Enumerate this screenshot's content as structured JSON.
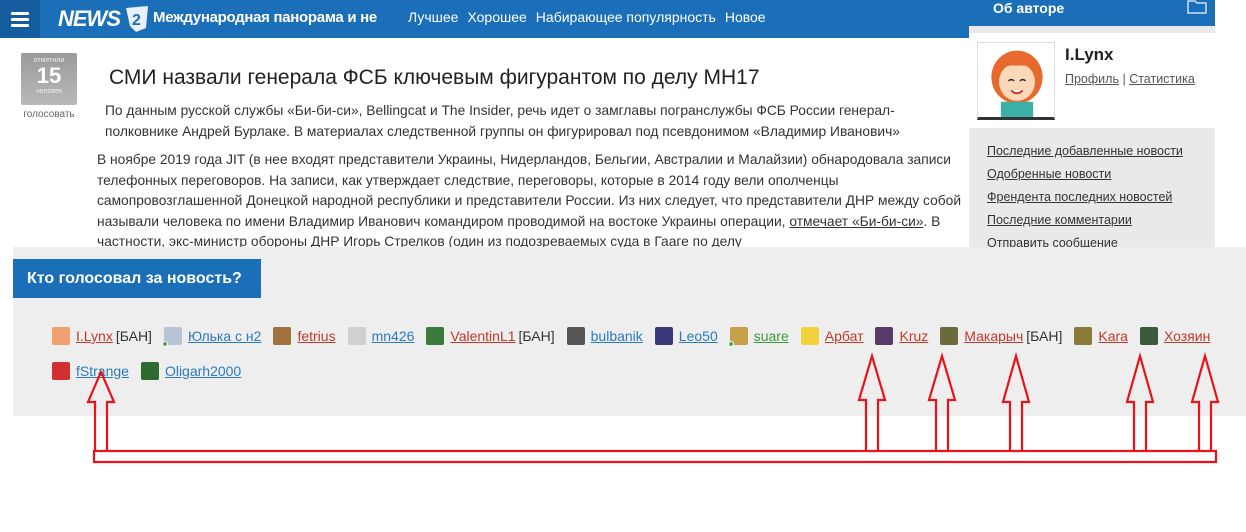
{
  "header": {
    "logo": "NEWS",
    "logo_badge": "2",
    "tagline": "Международная панорама и не",
    "nav": [
      "Лучшее",
      "Хорошее",
      "Набирающее популярность",
      "Новое"
    ]
  },
  "sidebar": {
    "title": "Об авторе",
    "author_name": "I.Lynx",
    "profile_link": "Профиль",
    "separator": "|",
    "stats_link": "Статистика",
    "links": [
      "Последние добавленные новости",
      "Одобренные новости",
      "Френдента последних новостей",
      "Последние комментарии",
      "Отправить сообщение"
    ]
  },
  "article": {
    "votes_top": "отметили",
    "votes_count": "15",
    "votes_unit": "человек",
    "vote_label": "голосовать",
    "title": "СМИ назвали генерала ФСБ ключевым фигурантом по делу MH17",
    "lead": "По данным русской службы «Би-би-си», Bellingcat и The Insider, речь идет о замглавы погранслужбы ФСБ России генерал-полковнике Андрей Бурлаке. В материалах следственной группы он фигурировал под псевдонимом «Владимир Иванович»",
    "body_main": "В ноябре 2019 года JIT (в нее входят представители Украины, Нидерландов, Бельгии, Австралии и Малайзии) обнародовала записи телефонных переговоров. На записи, как утверждает следствие, переговоры, которые в 2014 году вели ополченцы самопровозглашенной Донецкой народной республики и представители России. Из них следует, что представители ДНР между собой называли человека по имени Владимир Иванович командиром проводимой на востоке Украины операции,",
    "body_link": "отмечает «Би-би-си»",
    "body_tail": ". В частности, экс-министр обороны ДНР Игорь Стрелков (один из подозреваемых суда в Гааге по делу"
  },
  "voters": {
    "title": "Кто голосовал за новость?",
    "ban_label": "[БАН]",
    "rows": [
      [
        {
          "name": "I.Lynx",
          "color": "#c0392b",
          "ban": true,
          "av": "#f0a070",
          "online": false
        },
        {
          "name": "Юлька с н2",
          "color": "#2a7bbf",
          "ban": false,
          "av": "#b8c4d6",
          "online": true
        },
        {
          "name": "fetrius",
          "color": "#c0392b",
          "ban": false,
          "av": "#a0723d",
          "online": false
        },
        {
          "name": "mn426",
          "color": "#2a7bbf",
          "ban": false,
          "av": "#d0d0d0",
          "online": false
        },
        {
          "name": "ValentinL1",
          "color": "#c0392b",
          "ban": true,
          "av": "#3b7a3b",
          "online": false
        },
        {
          "name": "bulbanik",
          "color": "#2a7bbf",
          "ban": false,
          "av": "#555555",
          "online": false
        },
        {
          "name": "Leo50",
          "color": "#2a7bbf",
          "ban": false,
          "av": "#3a3a7a",
          "online": false
        },
        {
          "name": "suare",
          "color": "#3c9a3c",
          "ban": false,
          "av": "#c9a04a",
          "online": true
        },
        {
          "name": "Арбат",
          "color": "#c0392b",
          "ban": false,
          "av": "#f2d23c",
          "online": false
        },
        {
          "name": "Kruz",
          "color": "#c0392b",
          "ban": false,
          "av": "#5a3a6a",
          "online": false
        },
        {
          "name": "Макарыч",
          "color": "#c0392b",
          "ban": true,
          "av": "#6a6a3a",
          "online": false
        },
        {
          "name": "Kara",
          "color": "#c0392b",
          "ban": false,
          "av": "#8a7a3a",
          "online": false
        },
        {
          "name": "Хозяин",
          "color": "#c0392b",
          "ban": false,
          "av": "#3a5a3a",
          "online": false
        }
      ],
      [
        {
          "name": "fStrange",
          "color": "#2a7bbf",
          "ban": false,
          "av": "#d03030",
          "online": false
        },
        {
          "name": "Oligarh2000",
          "color": "#2a7bbf",
          "ban": false,
          "av": "#2f6a2f",
          "online": false
        }
      ]
    ]
  },
  "colors": {
    "brand": "#1b6fb8",
    "arrow": "#e8121b"
  }
}
